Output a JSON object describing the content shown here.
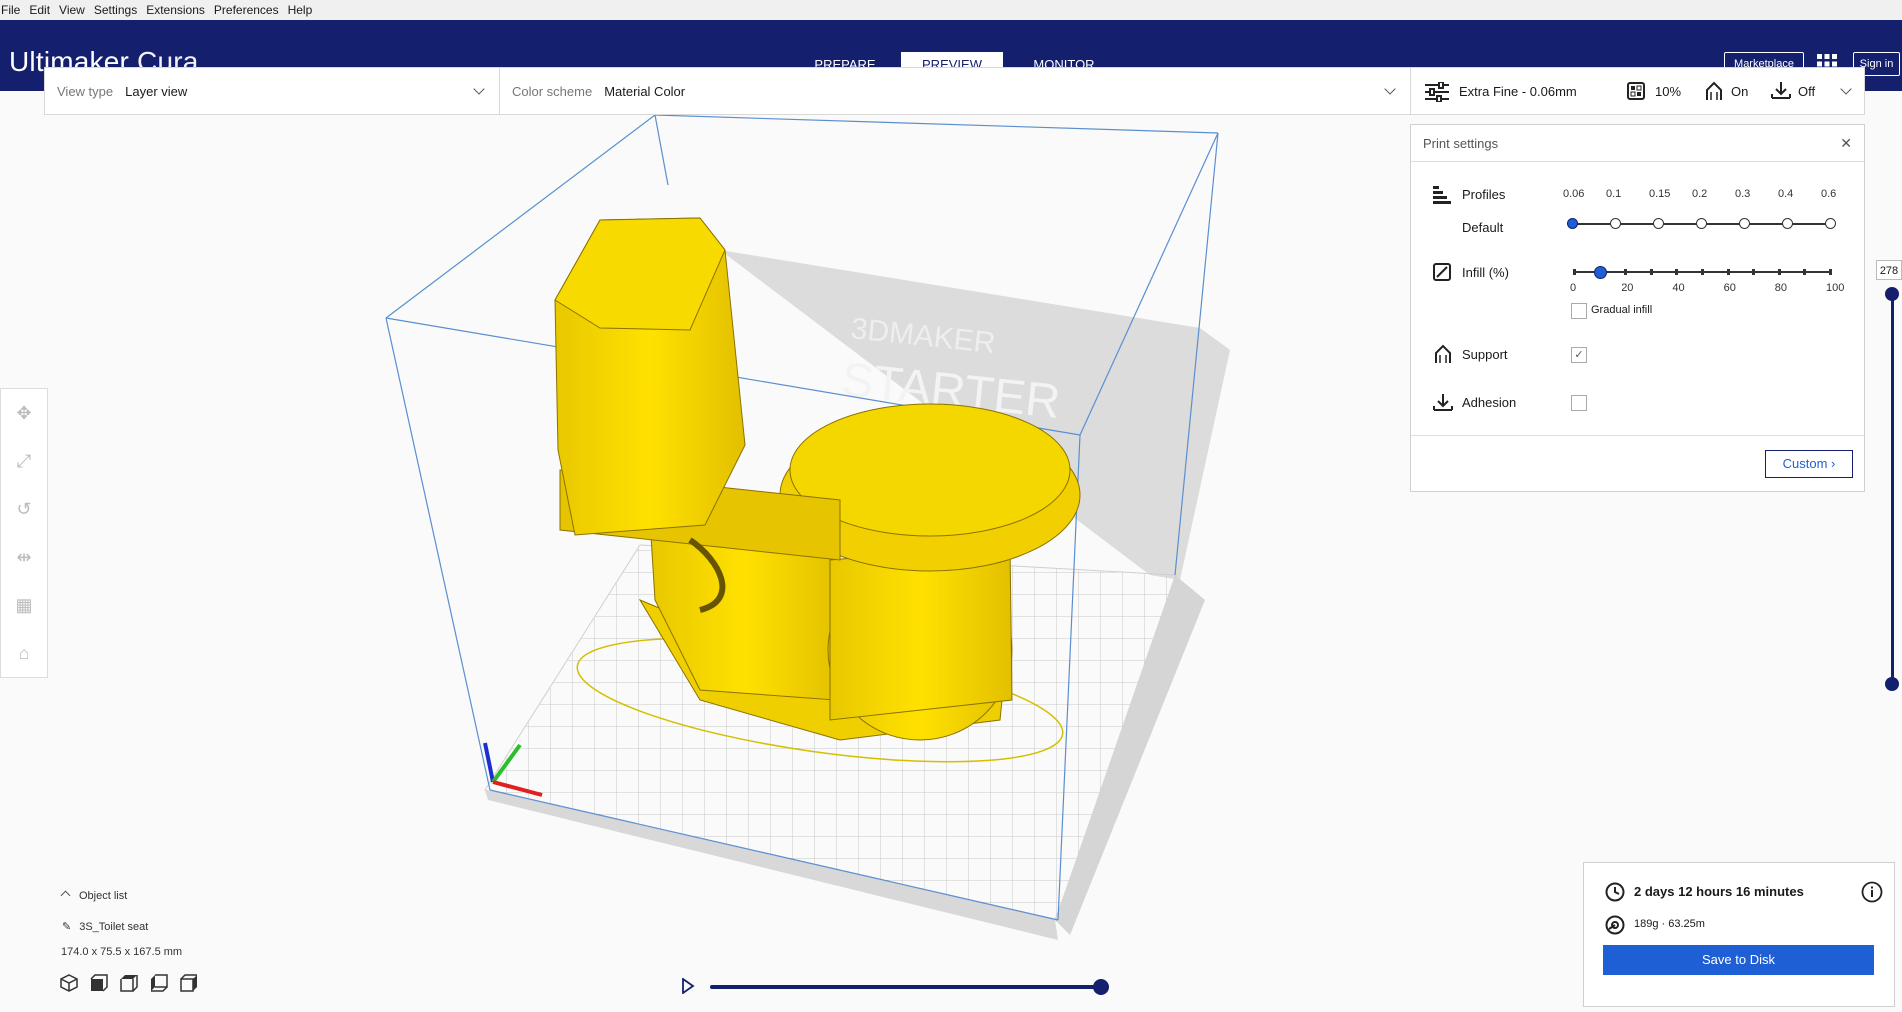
{
  "menu": [
    "File",
    "Edit",
    "View",
    "Settings",
    "Extensions",
    "Preferences",
    "Help"
  ],
  "app": {
    "title": "Ultimaker Cura",
    "brand": "Ultimaker",
    "product": "Cura"
  },
  "stages": {
    "prepare": "PREPARE",
    "preview": "PREVIEW",
    "monitor": "MONITOR"
  },
  "header_buttons": {
    "marketplace": "Marketplace",
    "signin": "Sign in"
  },
  "view_bar": {
    "view_type_label": "View type",
    "view_type_value": "Layer view",
    "color_scheme_label": "Color scheme",
    "color_scheme_value": "Material Color"
  },
  "settings_summary": {
    "profile": "Extra Fine - 0.06mm",
    "infill": "10%",
    "support": "On",
    "adhesion": "Off"
  },
  "print_settings": {
    "title": "Print settings",
    "profiles_label": "Profiles",
    "profile_default": "Default",
    "profile_ticks": [
      "0.06",
      "0.1",
      "0.15",
      "0.2",
      "0.3",
      "0.4",
      "0.6"
    ],
    "profile_selected_index": 0,
    "infill_label": "Infill (%)",
    "infill_ticks": [
      "0",
      "20",
      "40",
      "60",
      "80",
      "100"
    ],
    "infill_value": 10,
    "gradual_label": "Gradual infill",
    "gradual_checked": false,
    "support_label": "Support",
    "support_checked": true,
    "adhesion_label": "Adhesion",
    "adhesion_checked": false,
    "custom_label": "Custom"
  },
  "layer_slider": {
    "value": "278"
  },
  "object_list": {
    "toggle_label": "Object list",
    "object_name": "3S_Toilet seat",
    "dimensions": "174.0 x 75.5 x 167.5 mm"
  },
  "job": {
    "duration": "2 days 12 hours 16 minutes",
    "material": "189g · 63.25m",
    "save_label": "Save to Disk"
  },
  "colors": {
    "header": "#14206d",
    "accent": "#1f5fd6",
    "model": "#f7d400"
  }
}
